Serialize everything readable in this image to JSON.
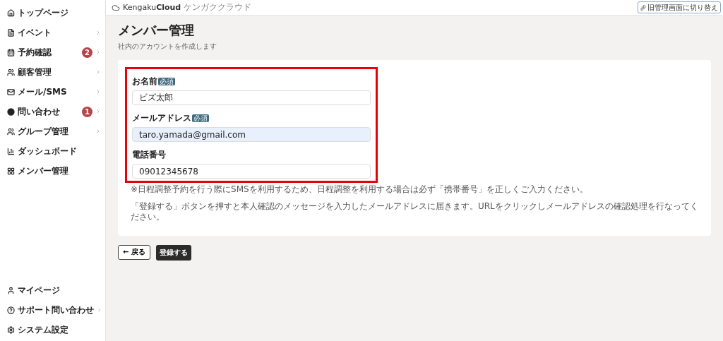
{
  "sidebar": {
    "items": [
      {
        "label": "トップページ",
        "expandable": false
      },
      {
        "label": "イベント",
        "expandable": true
      },
      {
        "label": "予約確認",
        "badge": "2",
        "expandable": true
      },
      {
        "label": "顧客管理",
        "expandable": true
      },
      {
        "label": "メール/SMS",
        "expandable": true
      },
      {
        "label": "問い合わせ",
        "badge": "1",
        "expandable": true
      },
      {
        "label": "グループ管理",
        "expandable": true
      },
      {
        "label": "ダッシュボード",
        "expandable": false
      },
      {
        "label": "メンバー管理",
        "expandable": false
      }
    ],
    "bottom_items": [
      {
        "label": "マイページ",
        "expandable": false
      },
      {
        "label": "サポート問い合わせ",
        "expandable": true
      },
      {
        "label": "システム設定",
        "expandable": false
      }
    ]
  },
  "header": {
    "logo": {
      "name": "Kengaku",
      "name_bold": "Cloud",
      "tagline": "ケンガククラウド"
    },
    "switch_button": "旧管理画面に切り替え"
  },
  "page": {
    "title": "メンバー管理",
    "subtitle": "社内のアカウントを作成します"
  },
  "form": {
    "fields": [
      {
        "label": "お名前",
        "required_tag": "必須",
        "value": "ビズ太郎",
        "autofilled": false
      },
      {
        "label": "メールアドレス",
        "required_tag": "必須",
        "value": "taro.yamada@gmail.com",
        "autofilled": true
      },
      {
        "label": "電話番号",
        "value": "09012345678",
        "autofilled": false
      }
    ],
    "notes": [
      "※日程調整予約を行う際にSMSを利用するため、日程調整を利用する場合は必ず「携帯番号」を正しくご入力ください。",
      "「登録する」ボタンを押すと本人確認のメッセージを入力したメールアドレスに届きます。URLをクリックしメールアドレスの確認処理を行なってください。"
    ]
  },
  "buttons": {
    "back": "← 戻る",
    "submit": "登録する"
  }
}
